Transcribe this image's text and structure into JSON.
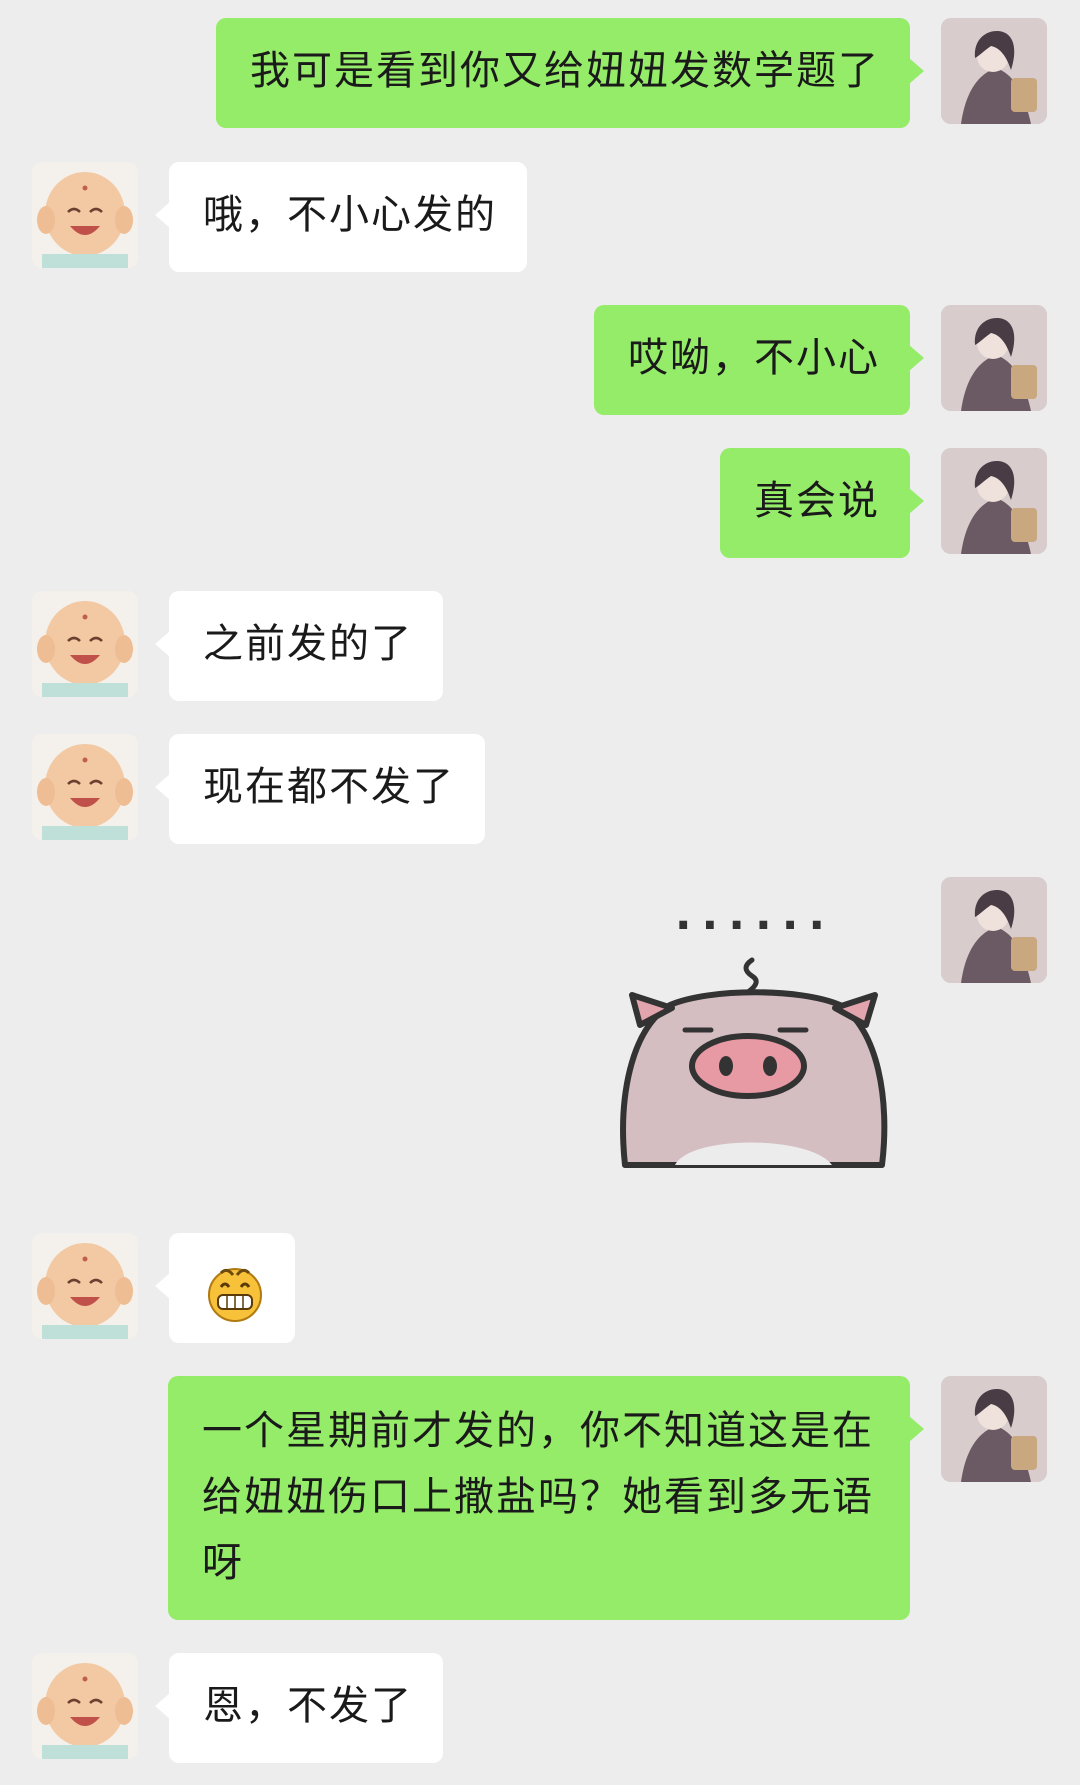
{
  "messages": [
    {
      "side": "out",
      "text": "我可是看到你又给妞妞发数学题了"
    },
    {
      "side": "in",
      "text": "哦，不小心发的"
    },
    {
      "side": "out",
      "text": "哎呦，不小心"
    },
    {
      "side": "out",
      "text": "真会说"
    },
    {
      "side": "in",
      "text": "之前发的了"
    },
    {
      "side": "in",
      "text": "现在都不发了"
    },
    {
      "side": "out",
      "sticker": "pig-sticker",
      "sticker_text": "······"
    },
    {
      "side": "in",
      "emoji": "grinning-face-icon"
    },
    {
      "side": "out",
      "text": "一个星期前才发的，你不知道这是在给妞妞伤口上撒盐吗？她看到多无语呀"
    },
    {
      "side": "in",
      "text": "恩，不发了"
    }
  ],
  "colors": {
    "background": "#ededed",
    "outgoing": "#95ec69",
    "incoming": "#ffffff"
  }
}
